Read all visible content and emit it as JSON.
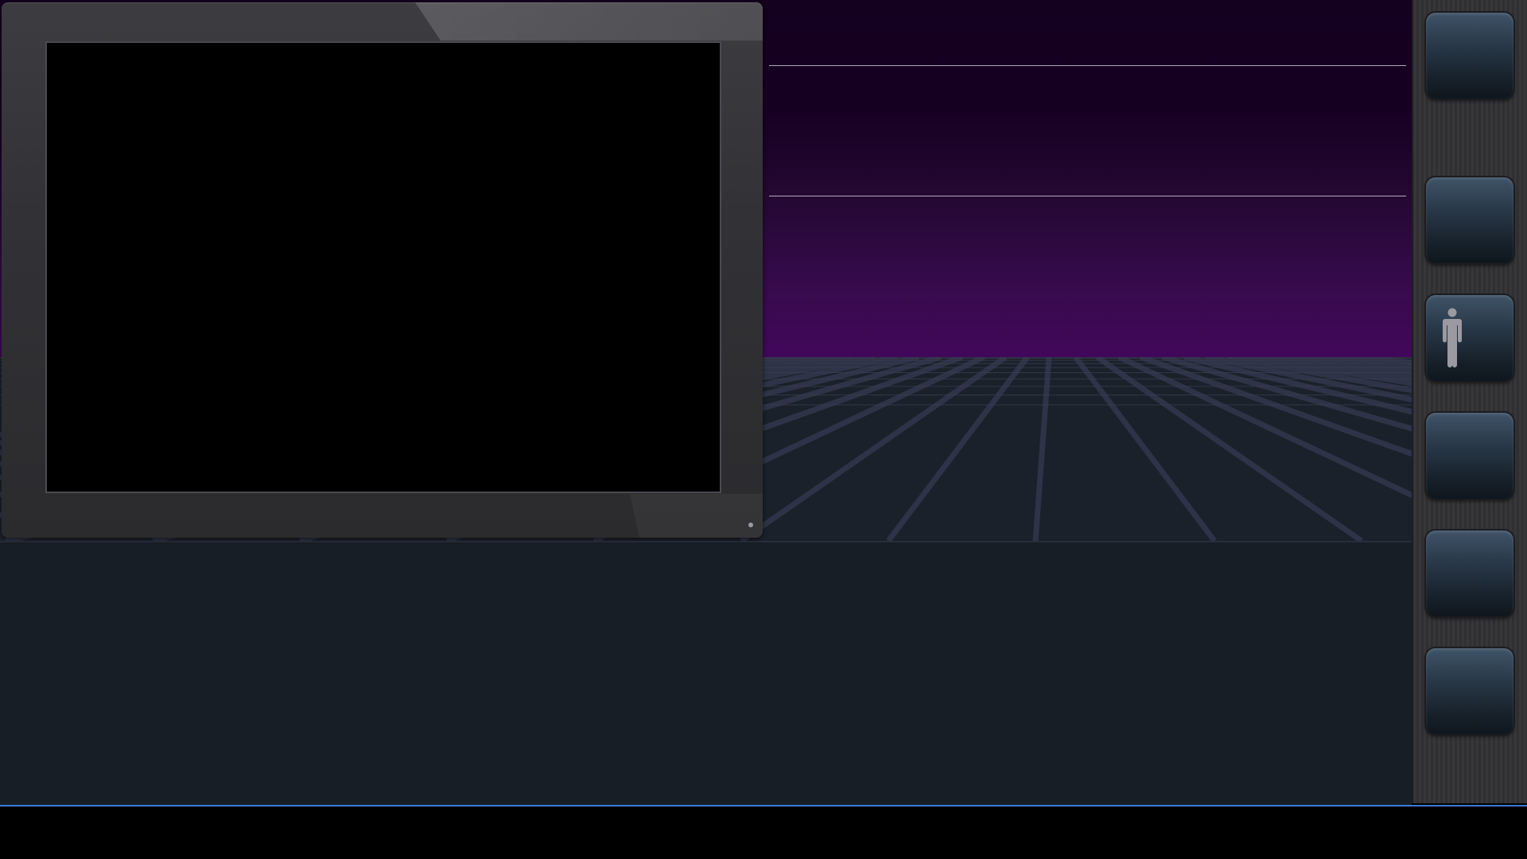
{
  "scene": {
    "sky_colors": [
      "#14001f",
      "#360a4c",
      "#42075a"
    ],
    "floor_color": "#1b212a",
    "grid_line_color": "#2e3347",
    "horizon_line_color": "#cfc7d8"
  },
  "monitor": {
    "screen_color": "#000000",
    "frame_color": "#333336",
    "power_led": "led"
  },
  "tool_rail": {
    "buttons": [
      {
        "name": "slot-1",
        "icon": ""
      },
      {
        "name": "slot-2",
        "icon": ""
      },
      {
        "name": "slot-3",
        "icon": "person-icon"
      },
      {
        "name": "slot-4",
        "icon": ""
      },
      {
        "name": "slot-5",
        "icon": ""
      },
      {
        "name": "slot-6",
        "icon": ""
      }
    ]
  },
  "bottom_panel": {
    "color": "#181e26",
    "divider_color": "#3b7bd6"
  }
}
